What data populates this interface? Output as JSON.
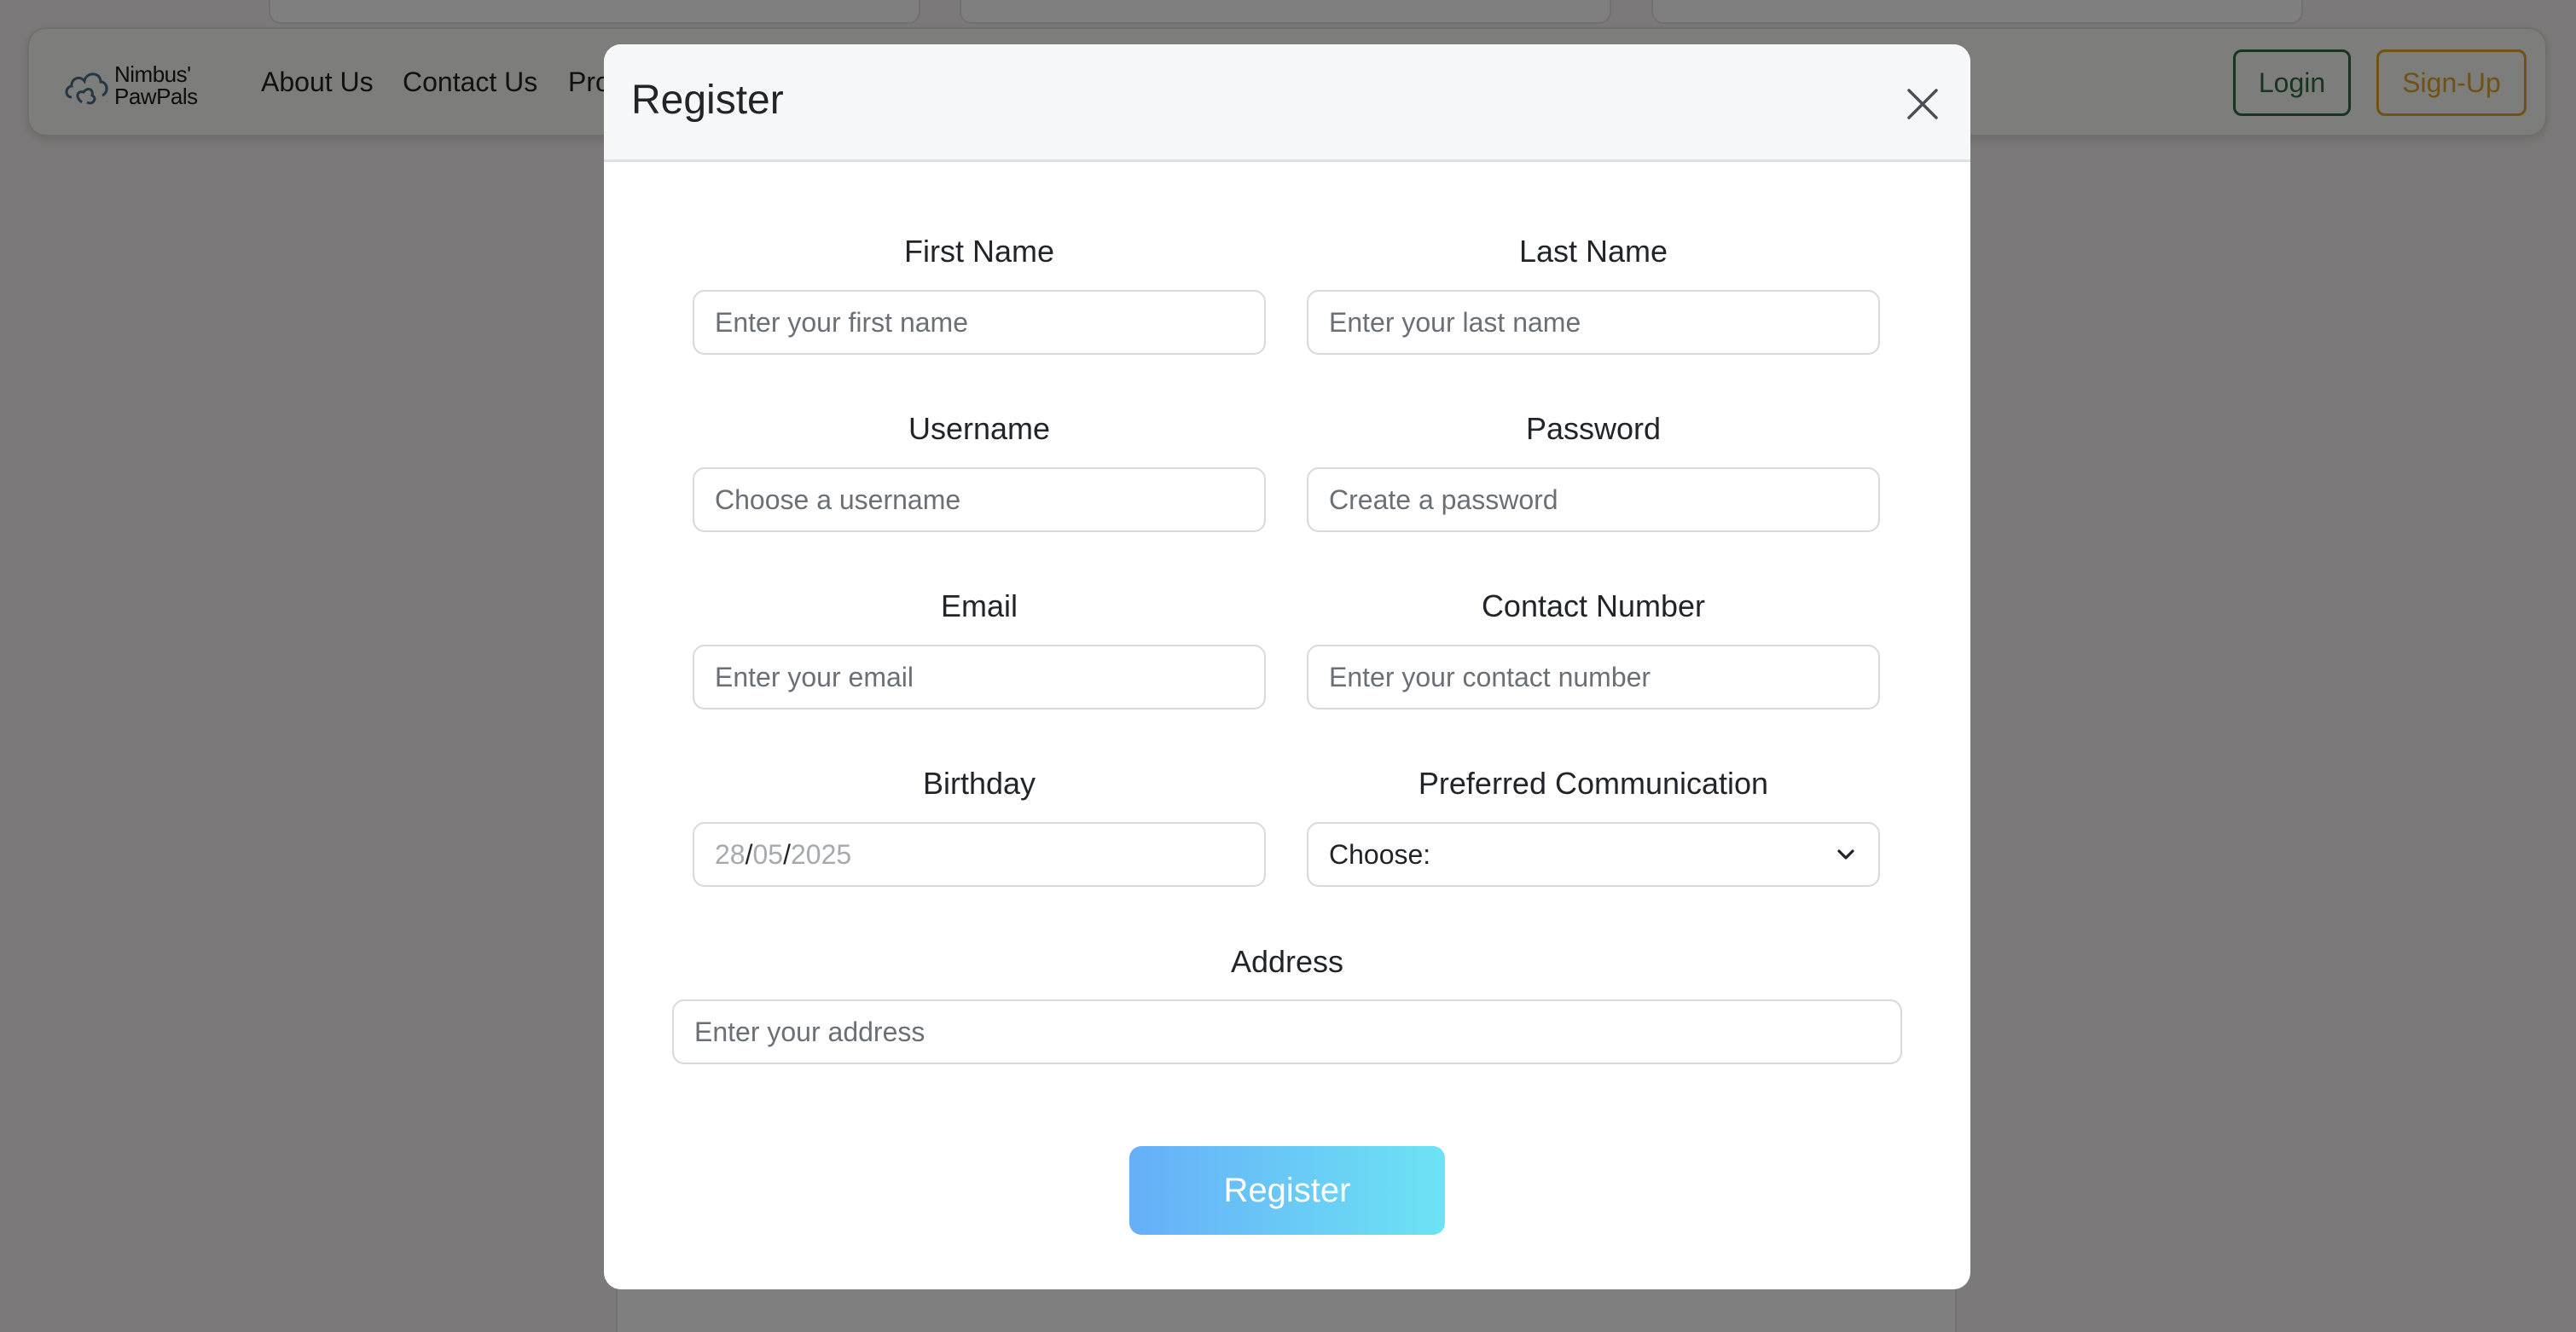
{
  "brand": {
    "name_line1": "Nimbus'",
    "name_line2": "PawPals"
  },
  "nav": {
    "about": "About Us",
    "contact": "Contact Us",
    "products_partial": "Pro",
    "login": "Login",
    "signup": "Sign-Up"
  },
  "modal": {
    "title": "Register",
    "fields": {
      "first_name": {
        "label": "First Name",
        "placeholder": "Enter your first name"
      },
      "last_name": {
        "label": "Last Name",
        "placeholder": "Enter your last name"
      },
      "username": {
        "label": "Username",
        "placeholder": "Choose a username"
      },
      "password": {
        "label": "Password",
        "placeholder": "Create a password"
      },
      "email": {
        "label": "Email",
        "placeholder": "Enter your email"
      },
      "contact": {
        "label": "Contact Number",
        "placeholder": "Enter your contact number"
      },
      "birthday": {
        "label": "Birthday",
        "day": "28",
        "month": "05",
        "year": "2025",
        "sep": "/"
      },
      "communication": {
        "label": "Preferred Communication",
        "selected": "Choose:"
      },
      "address": {
        "label": "Address",
        "placeholder": "Enter your address"
      }
    },
    "submit_label": "Register"
  },
  "colors": {
    "login_border": "#2f6b3f",
    "signup_border": "#e0a42a",
    "register_gradient_start": "#66aff8",
    "register_gradient_end": "#6ce3f4"
  }
}
